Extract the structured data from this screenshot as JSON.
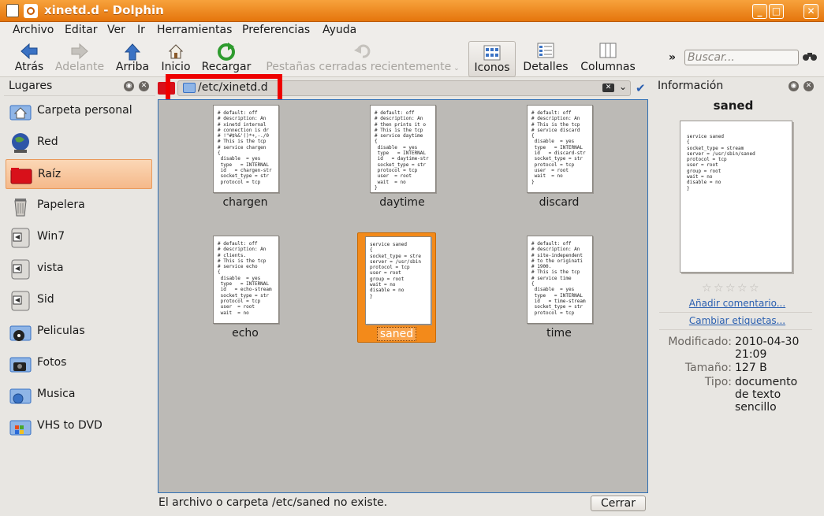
{
  "window": {
    "title": "xinetd.d - Dolphin"
  },
  "menu": [
    "Archivo",
    "Editar",
    "Ver",
    "Ir",
    "Herramientas",
    "Preferencias",
    "Ayuda"
  ],
  "toolbar": {
    "back": "Atrás",
    "forward": "Adelante",
    "up": "Arriba",
    "home": "Inicio",
    "reload": "Recargar",
    "closed_tabs": "Pestañas cerradas recientemente",
    "view_icons": "Iconos",
    "view_details": "Detalles",
    "view_columns": "Columnas",
    "more": "»",
    "search_placeholder": "Buscar..."
  },
  "places": {
    "title": "Lugares",
    "items": [
      {
        "label": "Carpeta personal",
        "icon": "home-folder-icon"
      },
      {
        "label": "Red",
        "icon": "network-globe-icon"
      },
      {
        "label": "Raíz",
        "icon": "red-folder-icon",
        "selected": true
      },
      {
        "label": "Papelera",
        "icon": "trash-icon"
      },
      {
        "label": "Win7",
        "icon": "drive-icon"
      },
      {
        "label": "vista",
        "icon": "drive-icon"
      },
      {
        "label": "Sid",
        "icon": "drive-icon"
      },
      {
        "label": "Peliculas",
        "icon": "film-folder-icon"
      },
      {
        "label": "Fotos",
        "icon": "camera-folder-icon"
      },
      {
        "label": "Musica",
        "icon": "music-folder-icon"
      },
      {
        "label": "VHS to DVD",
        "icon": "windows-folder-icon"
      }
    ]
  },
  "location": {
    "path": "/etc/xinetd.d"
  },
  "files": [
    {
      "name": "chargen",
      "preview": "# default: off\n# description: An\n# xinetd internal\n# connection is dr\n# !\"#$%&'()*+,-./0\n# This is the tcp\n# service chargen\n{\n disable  = yes\n type   = INTERNAL\n id   = chargen-str\n socket_type = str\n protocol = tcp"
    },
    {
      "name": "daytime",
      "preview": "# default: off\n# description: An\n# then prints it o\n# This is the tcp\n# service daytime\n{\n disable  = yes\n type   = INTERNAL\n id   = daytime-str\n socket_type = str\n protocol = tcp\n user  = root\n wait  = no\n}"
    },
    {
      "name": "discard",
      "preview": "# default: off\n# description: An\n# This is the tcp\n# service discard\n{\n disable  = yes\n type   = INTERNAL\n id   = discard-str\n socket_type = str\n protocol = tcp\n user  = root\n wait  = no\n}"
    },
    {
      "name": "echo",
      "preview": "# default: off\n# description: An\n# clients.\n# This is the tcp\n# service echo\n{\n disable  = yes\n type   = INTERNAL\n id   = echo-stream\n socket_type = str\n protocol = tcp\n user  = root\n wait  = no"
    },
    {
      "name": "saned",
      "selected": true,
      "preview": "service saned\n{\nsocket_type = stre\nserver = /usr/sbin\nprotocol = tcp\nuser = root\ngroup = root\nwait = no\ndisable = no\n}"
    },
    {
      "name": "time",
      "preview": "# default: off\n# description: An\n# site-independent\n# to the originati\n# 1900.\n# This is the tcp\n# service time\n{\n disable  = yes\n type   = INTERNAL\n id   = time-stream\n socket_type = str\n protocol = tcp"
    }
  ],
  "status": {
    "message": "El archivo o carpeta /etc/saned no existe.",
    "close_label": "Cerrar"
  },
  "info": {
    "title": "Información",
    "file_name": "saned",
    "preview": "service saned\n{\nsocket_type = stream\nserver = /usr/sbin/saned\nprotocol = tcp\nuser = root\ngroup = root\nwait = no\ndisable = no\n}",
    "rating": 0,
    "add_comment": "Añadir comentario...",
    "change_tags": "Cambiar etiquetas...",
    "modified_label": "Modificado:",
    "modified_value": "2010-04-30 21:09",
    "size_label": "Tamaño:",
    "size_value": "127 B",
    "type_label": "Tipo:",
    "type_value": "documento de texto sencillo"
  },
  "colors": {
    "accent": "#f38a1a",
    "selection_place": "#f5b98a",
    "link": "#2a5fb0",
    "highlight_box": "#ee0000"
  }
}
